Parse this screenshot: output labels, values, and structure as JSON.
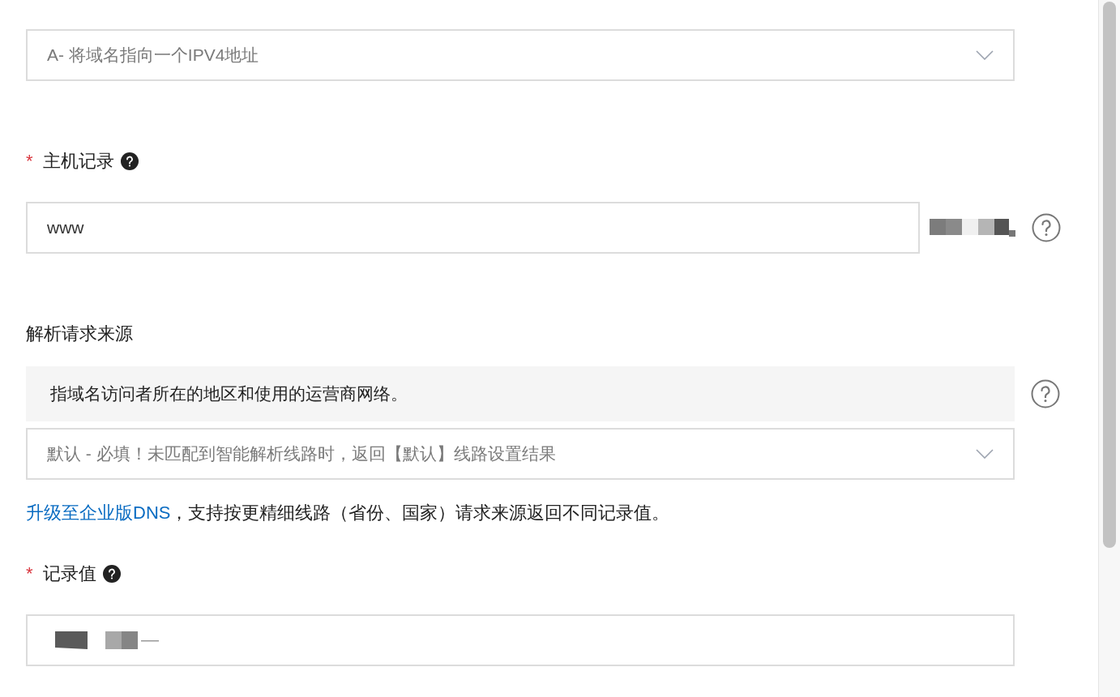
{
  "record_type_select": {
    "value": "A- 将域名指向一个IPV4地址"
  },
  "host_record": {
    "required_mark": "*",
    "label": "主机记录",
    "value": "www"
  },
  "request_source": {
    "label": "解析请求来源",
    "description": "指域名访问者所在的地区和使用的运营商网络。",
    "select_value": "默认 - 必填！未匹配到智能解析线路时，返回【默认】线路设置结果"
  },
  "upgrade_note": {
    "link": "升级至企业版DNS",
    "text": "，支持按更精细线路（省份、国家）请求来源返回不同记录值。"
  },
  "record_value": {
    "required_mark": "*",
    "label": "记录值"
  }
}
